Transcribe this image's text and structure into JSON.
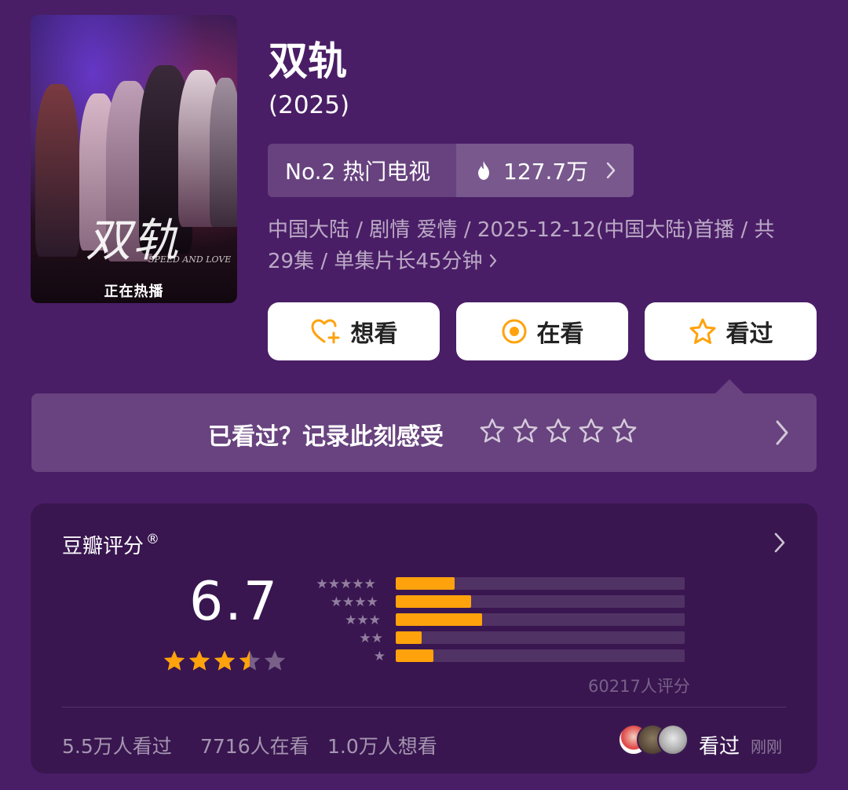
{
  "poster": {
    "title_art": "双轨",
    "subtitle_art": "SPEED AND LOVE",
    "badge": "正在热播"
  },
  "header": {
    "title": "双轨",
    "year": "(2025)"
  },
  "rank": {
    "label": "No.2 热门电视",
    "heat": "127.7万"
  },
  "meta": {
    "line": "中国大陆 / 剧情 爱情 / 2025-12-12(中国大陆)首播 / 共29集 / 单集片长45分钟"
  },
  "actions": {
    "want_label": "想看",
    "watching_label": "在看",
    "watched_label": "看过"
  },
  "record": {
    "prompt": "已看过？记录此刻感受",
    "star_count": 5
  },
  "rating": {
    "title": "豆瓣评分",
    "title_mark": "®",
    "score": "6.7",
    "score_stars_out_of_5": 3.5,
    "distribution": [
      {
        "stars": "★★★★★",
        "share": 0.205
      },
      {
        "stars": "★★★★",
        "share": 0.26
      },
      {
        "stars": "★★★",
        "share": 0.3
      },
      {
        "stars": "★★",
        "share": 0.09
      },
      {
        "stars": "★",
        "share": 0.13
      }
    ],
    "count_text": "60217人评分",
    "colors": {
      "accent": "#ffa20c",
      "track": "rgba(255,255,255,0.12)"
    }
  },
  "stats": {
    "watched": "5.5万人看过",
    "watching": "7716人在看",
    "want": "1.0万人想看"
  },
  "friends": {
    "action": "看过",
    "time": "刚刚"
  },
  "colors": {
    "background": "#4a1e66",
    "star_active": "#ffa20c",
    "button_icon": "#ffa20c"
  }
}
